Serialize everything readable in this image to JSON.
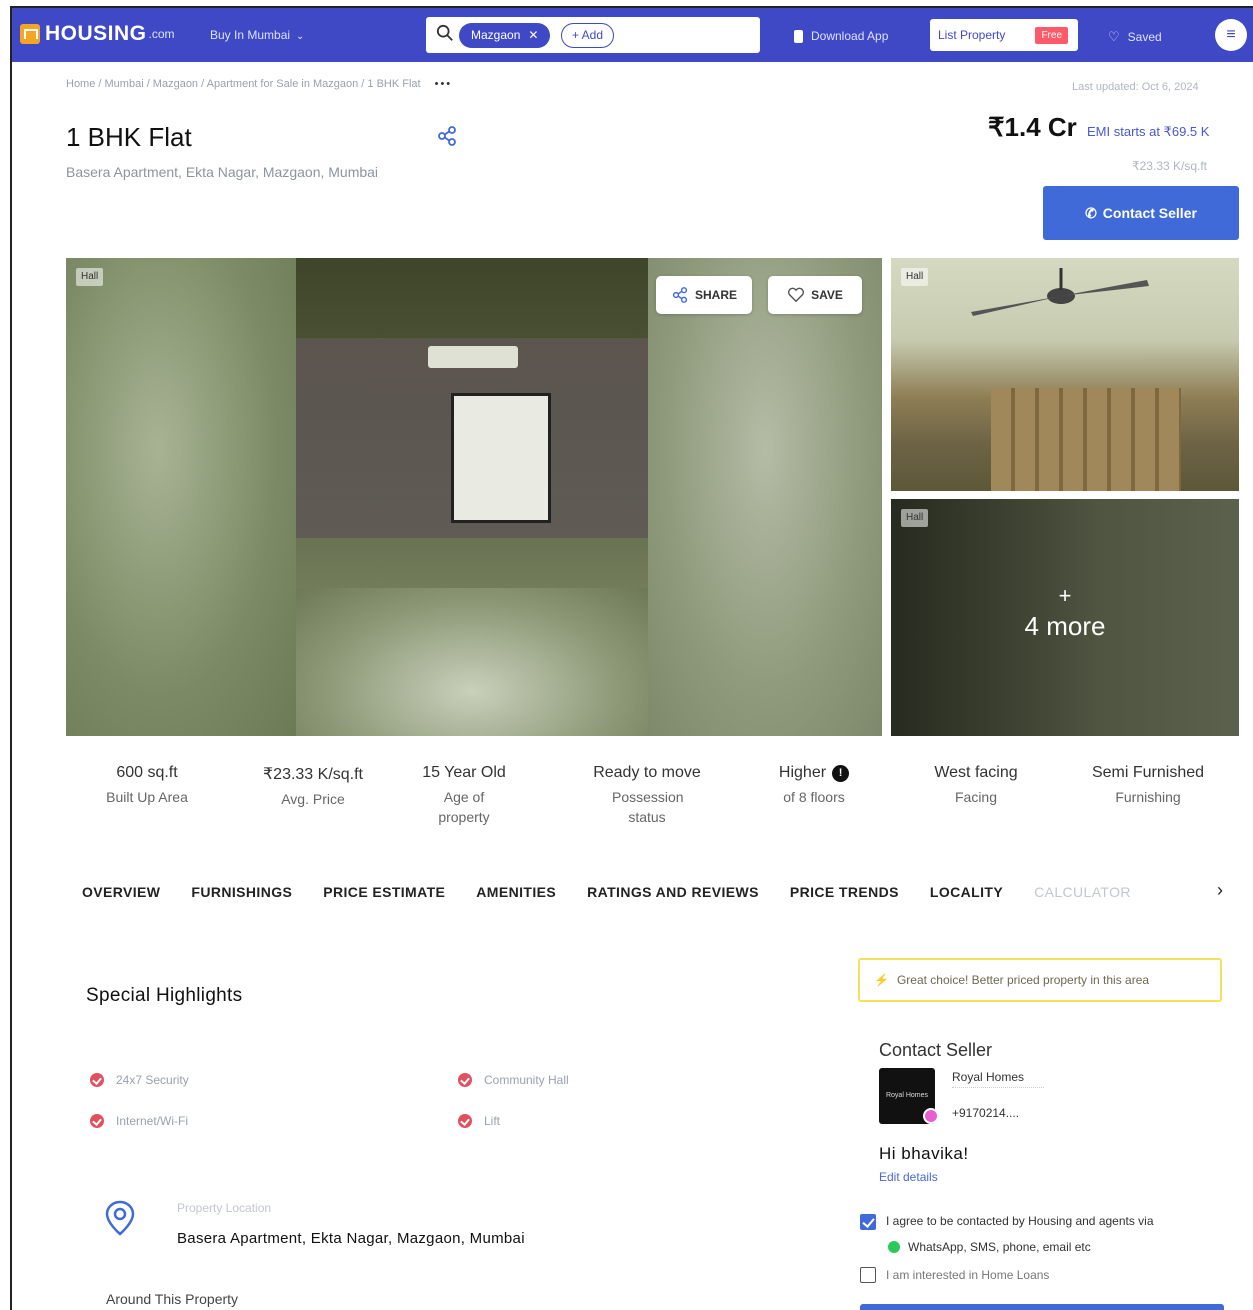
{
  "header": {
    "logo_text": "HOUSING",
    "logo_domain": ".com",
    "buy_in": "Buy In Mumbai",
    "search_chip": "Mazgaon",
    "add_chip": "+ Add",
    "download_app": "Download App",
    "list_property": "List Property",
    "free_badge": "Free",
    "saved": "Saved"
  },
  "breadcrumb": "Home / Mumbai / Mazgaon / Apartment for Sale in Mazgaon / 1 BHK Flat",
  "breadcrumb_more": "•••",
  "last_updated": "Last updated: Oct 6, 2024",
  "listing": {
    "title": "1 BHK Flat",
    "address": "Basera Apartment, Ekta Nagar, Mazgaon, Mumbai",
    "price": "₹1.4 Cr",
    "emi": "EMI starts at ₹69.5 K",
    "price_per_sqft": "₹23.33 K/sq.ft",
    "contact_button": "Contact Seller"
  },
  "gallery": {
    "main_tag": "Hall",
    "share_label": "SHARE",
    "save_label": "SAVE",
    "thumb1_tag": "Hall",
    "thumb2_tag": "Hall",
    "more_plus": "+",
    "more_label": "4 more"
  },
  "stats": [
    {
      "value": "600 sq.ft",
      "label": "Built Up Area"
    },
    {
      "value": "₹23.33 K/sq.ft",
      "label": "Avg. Price"
    },
    {
      "value": "15 Year Old",
      "label": "Age of property"
    },
    {
      "value": "Ready to move",
      "label": "Possession status"
    },
    {
      "value": "Higher",
      "label": "of 8 floors"
    },
    {
      "value": "West facing",
      "label": "Facing"
    },
    {
      "value": "Semi Furnished",
      "label": "Furnishing"
    }
  ],
  "tabs": [
    "OVERVIEW",
    "FURNISHINGS",
    "PRICE ESTIMATE",
    "AMENITIES",
    "RATINGS AND REVIEWS",
    "PRICE TRENDS",
    "LOCALITY",
    "CALCULATOR"
  ],
  "highlights": {
    "title": "Special Highlights",
    "items": [
      "24x7 Security",
      "Community Hall",
      "Internet/Wi-Fi",
      "Lift"
    ]
  },
  "location": {
    "label": "Property Location",
    "value": "Basera Apartment, Ekta Nagar, Mazgaon, Mumbai"
  },
  "around": "Around This Property",
  "right_panel": {
    "great_choice": "Great choice! Better priced property in this area",
    "contact_title": "Contact Seller",
    "avatar_text": "Royal Homes",
    "seller_name": "Royal Homes",
    "seller_phone": "+9170214....",
    "greeting": "Hi bhavika!",
    "edit_details": "Edit details",
    "agree_text": "I agree to be contacted by Housing and agents via",
    "agree_channels": "WhatsApp, SMS, phone, email etc",
    "home_loans": "I am interested in Home Loans"
  },
  "colors": {
    "brand": "#3f49c6",
    "cta": "#3f6ad8",
    "highlight_red": "#e0505f",
    "free_badge": "#ff5a6a"
  }
}
